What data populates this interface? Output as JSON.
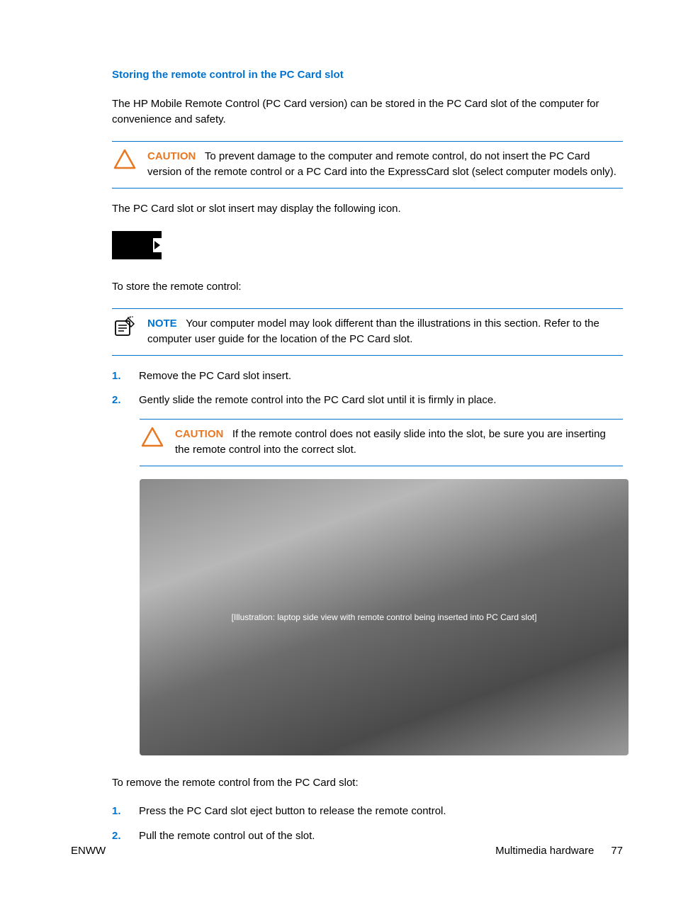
{
  "heading": "Storing the remote control in the PC Card slot",
  "intro": "The HP Mobile Remote Control (PC Card version) can be stored in the PC Card slot of the computer for convenience and safety.",
  "caution1": {
    "label": "CAUTION",
    "text": "To prevent damage to the computer and remote control, do not insert the PC Card version of the remote control or a PC Card into the ExpressCard slot (select computer models only)."
  },
  "iconLine": "The PC Card slot or slot insert may display the following icon.",
  "storeLine": "To store the remote control:",
  "note1": {
    "label": "NOTE",
    "text": "Your computer model may look different than the illustrations in this section. Refer to the computer user guide for the location of the PC Card slot."
  },
  "steps1": [
    {
      "num": "1.",
      "text": "Remove the PC Card slot insert."
    },
    {
      "num": "2.",
      "text": "Gently slide the remote control into the PC Card slot until it is firmly in place."
    }
  ],
  "caution2": {
    "label": "CAUTION",
    "text": "If the remote control does not easily slide into the slot, be sure you are inserting the remote control into the correct slot."
  },
  "imageAlt": "[Illustration: laptop side view with remote control being inserted into PC Card slot]",
  "removeLine": "To remove the remote control from the PC Card slot:",
  "steps2": [
    {
      "num": "1.",
      "text": "Press the PC Card slot eject button to release the remote control."
    },
    {
      "num": "2.",
      "text": "Pull the remote control out of the slot."
    }
  ],
  "footer": {
    "left": "ENWW",
    "section": "Multimedia hardware",
    "page": "77"
  }
}
